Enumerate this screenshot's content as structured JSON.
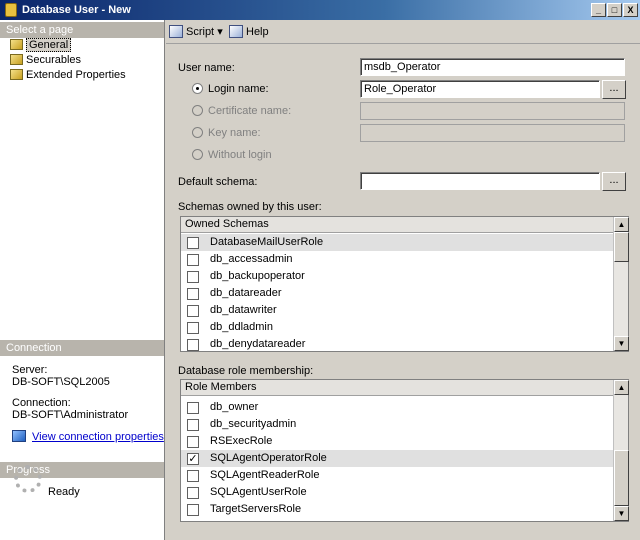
{
  "window": {
    "title": "Database User - New",
    "controls": {
      "minimize": "_",
      "maximize": "□",
      "close": "X"
    }
  },
  "sidebar": {
    "select_page_header": "Select a page",
    "pages": [
      {
        "label": "General",
        "icon": "page-icon",
        "selected": true
      },
      {
        "label": "Securables",
        "icon": "page-icon",
        "selected": false
      },
      {
        "label": "Extended Properties",
        "icon": "page-icon",
        "selected": false
      }
    ],
    "connection": {
      "header": "Connection",
      "server_label": "Server:",
      "server_value": "DB-SOFT\\SQL2005",
      "connection_label": "Connection:",
      "connection_value": "DB-SOFT\\Administrator",
      "view_properties_link": "View connection properties"
    },
    "progress": {
      "header": "Progress",
      "status": "Ready"
    }
  },
  "toolbar": {
    "script_label": "Script",
    "dropdown_arrow": "▾",
    "help_label": "Help"
  },
  "form": {
    "user_name_label": "User name:",
    "user_name_value": "msdb_Operator",
    "login_name_label": "Login name:",
    "login_name_value": "Role_Operator",
    "certificate_name_label": "Certificate name:",
    "key_name_label": "Key name:",
    "without_login_label": "Without login",
    "default_schema_label": "Default schema:",
    "default_schema_value": "",
    "browse_button": "..."
  },
  "schemas": {
    "section_label": "Schemas owned by this user:",
    "column_header": "Owned Schemas",
    "rows": [
      {
        "label": "DatabaseMailUserRole",
        "checked": false,
        "selected": true
      },
      {
        "label": "db_accessadmin",
        "checked": false,
        "selected": false
      },
      {
        "label": "db_backupoperator",
        "checked": false,
        "selected": false
      },
      {
        "label": "db_datareader",
        "checked": false,
        "selected": false
      },
      {
        "label": "db_datawriter",
        "checked": false,
        "selected": false
      },
      {
        "label": "db_ddladmin",
        "checked": false,
        "selected": false
      },
      {
        "label": "db_denydatareader",
        "checked": false,
        "selected": false
      }
    ]
  },
  "roles": {
    "section_label": "Database role membership:",
    "column_header": "Role Members",
    "rows": [
      {
        "label": "db_owner",
        "checked": false,
        "selected": false
      },
      {
        "label": "db_securityadmin",
        "checked": false,
        "selected": false
      },
      {
        "label": "RSExecRole",
        "checked": false,
        "selected": false
      },
      {
        "label": "SQLAgentOperatorRole",
        "checked": true,
        "selected": true
      },
      {
        "label": "SQLAgentReaderRole",
        "checked": false,
        "selected": false
      },
      {
        "label": "SQLAgentUserRole",
        "checked": false,
        "selected": false
      },
      {
        "label": "TargetServersRole",
        "checked": false,
        "selected": false
      }
    ]
  },
  "scrollbar": {
    "up": "▲",
    "down": "▼"
  },
  "checkmark": "✓"
}
